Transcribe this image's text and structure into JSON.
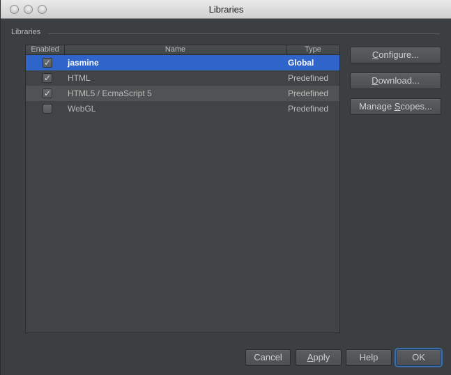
{
  "window": {
    "title": "Libraries"
  },
  "group": {
    "label": "Libraries"
  },
  "table": {
    "headers": [
      "Enabled",
      "Name",
      "Type"
    ],
    "rows": [
      {
        "enabled": true,
        "name": "jasmine",
        "type": "Global",
        "selected": true
      },
      {
        "enabled": true,
        "name": "HTML",
        "type": "Predefined",
        "selected": false
      },
      {
        "enabled": true,
        "name": "HTML5 / EcmaScript 5",
        "type": "Predefined",
        "selected": false
      },
      {
        "enabled": false,
        "name": "WebGL",
        "type": "Predefined",
        "selected": false
      }
    ]
  },
  "side_buttons": {
    "configure": {
      "mnemonic": "C",
      "rest": "onfigure..."
    },
    "download": {
      "mnemonic": "D",
      "rest": "ownload..."
    },
    "manage_scopes": {
      "pre": "Manage ",
      "mnemonic": "S",
      "rest": "copes..."
    }
  },
  "footer": {
    "cancel": "Cancel",
    "apply": {
      "mnemonic": "A",
      "rest": "pply"
    },
    "help": "Help",
    "ok": "OK"
  },
  "icons": {
    "check": "✓"
  }
}
